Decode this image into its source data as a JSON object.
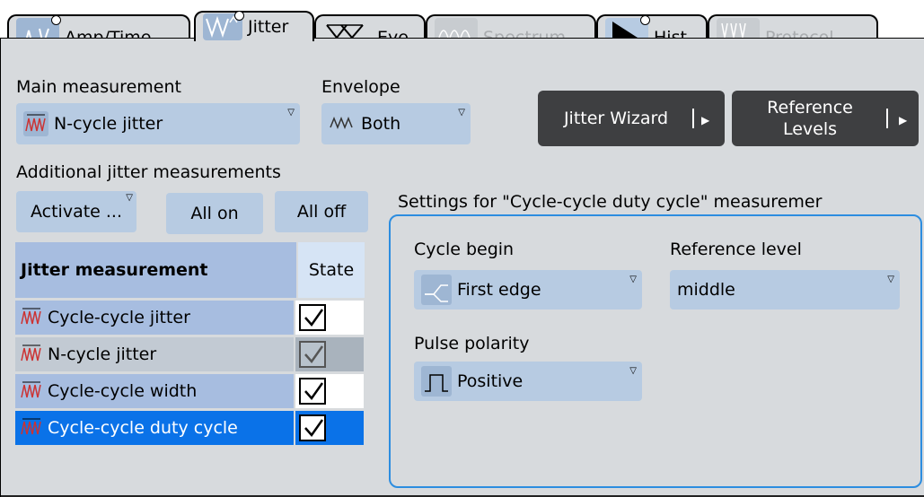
{
  "tabs": [
    {
      "label": "Amp/Time",
      "icon": "amp-time-icon",
      "active": false,
      "disabled": false
    },
    {
      "label": "Jitter",
      "icon": "jitter-icon",
      "active": true,
      "disabled": false
    },
    {
      "label": "Eye",
      "icon": "eye-diagram-icon",
      "active": false,
      "disabled": false
    },
    {
      "label": "Spectrum",
      "icon": "spectrum-icon",
      "active": false,
      "disabled": true
    },
    {
      "label": "Hist",
      "icon": "histogram-icon",
      "active": false,
      "disabled": false
    },
    {
      "label": "Protocol",
      "icon": "protocol-icon",
      "active": false,
      "disabled": true
    }
  ],
  "main_measurement": {
    "label": "Main measurement",
    "value": "N-cycle jitter"
  },
  "envelope": {
    "label": "Envelope",
    "value": "Both"
  },
  "buttons": {
    "jitter_wizard": "Jitter Wizard",
    "reference_levels_line1": "Reference",
    "reference_levels_line2": "Levels"
  },
  "additional": {
    "label": "Additional jitter measurements",
    "activate": "Activate ...",
    "all_on": "All on",
    "all_off": "All off"
  },
  "table": {
    "header_name": "Jitter measurement",
    "header_state": "State",
    "rows": [
      {
        "name": "Cycle-cycle jitter",
        "checked": true,
        "disabled": false,
        "selected": false
      },
      {
        "name": "N-cycle jitter",
        "checked": true,
        "disabled": true,
        "selected": false
      },
      {
        "name": "Cycle-cycle width",
        "checked": true,
        "disabled": false,
        "selected": false
      },
      {
        "name": "Cycle-cycle duty cycle",
        "checked": true,
        "disabled": false,
        "selected": true
      }
    ]
  },
  "settings": {
    "title": "Settings for \"Cycle-cycle duty cycle\" measuremer",
    "cycle_begin_label": "Cycle begin",
    "cycle_begin_value": "First edge",
    "reference_level_label": "Reference level",
    "reference_level_value": "middle",
    "pulse_polarity_label": "Pulse polarity",
    "pulse_polarity_value": "Positive"
  },
  "colors": {
    "panel": "#d7dadd",
    "field": "#b7cbe2",
    "header": "#a7bde0",
    "selected": "#0a72e8",
    "focus_border": "#2c8de0",
    "dark_button": "#3e3f41"
  }
}
